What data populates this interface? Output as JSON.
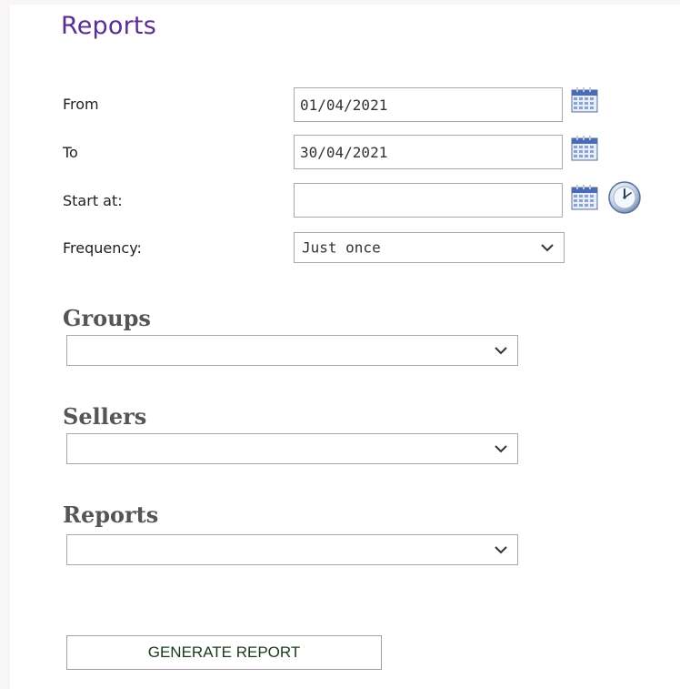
{
  "page": {
    "title": "Reports"
  },
  "colors": {
    "title": "#5b2c91",
    "heading": "#555555",
    "border": "#a9a9a9"
  },
  "form": {
    "from": {
      "label": "From",
      "value": "01/04/2021",
      "icon": "calendar-icon"
    },
    "to": {
      "label": "To",
      "value": "30/04/2021",
      "icon": "calendar-icon"
    },
    "start_at": {
      "label": "Start at:",
      "value": "",
      "icons": [
        "calendar-icon",
        "clock-icon"
      ]
    },
    "frequency": {
      "label": "Frequency:",
      "selected": "Just once"
    }
  },
  "sections": {
    "groups": {
      "heading": "Groups",
      "selected": ""
    },
    "sellers": {
      "heading": "Sellers",
      "selected": ""
    },
    "reports": {
      "heading": "Reports",
      "selected": ""
    }
  },
  "actions": {
    "generate_label": "GENERATE REPORT"
  }
}
